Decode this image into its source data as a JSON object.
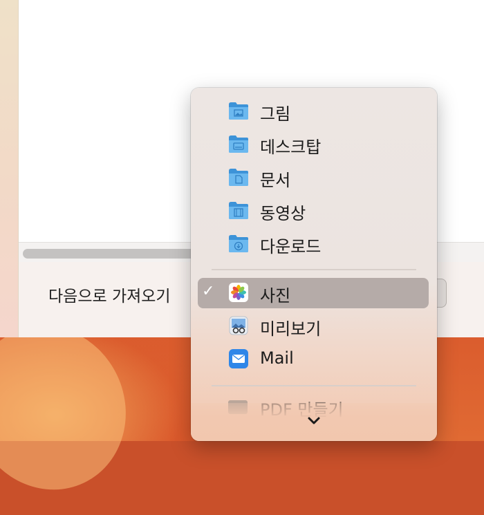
{
  "dialog": {
    "import_label": "다음으로 가져오기"
  },
  "menu": {
    "folders": [
      {
        "label": "그림",
        "icon": "pictures-folder-icon"
      },
      {
        "label": "데스크탑",
        "icon": "desktop-folder-icon"
      },
      {
        "label": "문서",
        "icon": "documents-folder-icon"
      },
      {
        "label": "동영상",
        "icon": "movies-folder-icon"
      },
      {
        "label": "다운로드",
        "icon": "downloads-folder-icon"
      }
    ],
    "apps": [
      {
        "label": "사진",
        "icon": "photos-app-icon",
        "selected": true
      },
      {
        "label": "미리보기",
        "icon": "preview-app-icon",
        "selected": false
      },
      {
        "label": "Mail",
        "icon": "mail-app-icon",
        "selected": false
      }
    ],
    "partial_item": "PDF 만들기",
    "checkmark": "✓"
  },
  "colors": {
    "folder_blue": "#4aa3e6",
    "selection": "#b5aba8",
    "wallpaper": "#d7532a"
  }
}
